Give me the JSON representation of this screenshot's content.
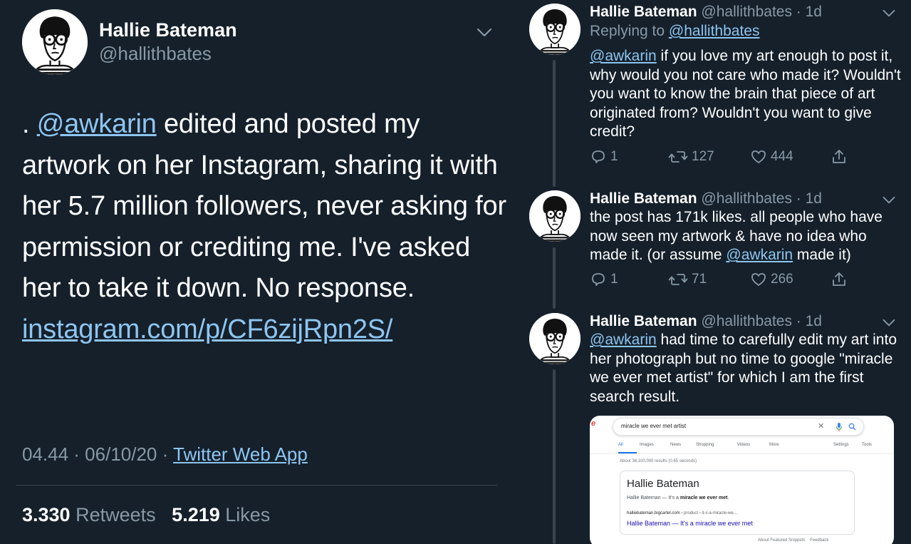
{
  "main_tweet": {
    "author_name": "Hallie Bateman",
    "author_handle": "@hallithbates",
    "text_prefix": ". ",
    "mention": "@awkarin",
    "text_body": " edited and posted my artwork on her Instagram, sharing it with her 5.7 million followers, never asking for permission or crediting me. I've asked her to take it down. No response. ",
    "link_text": "instagram.com/p/​CF6zijRpn2S/",
    "timestamp": "04.44 · 06/10/20 · ",
    "source": "Twitter Web App",
    "retweets_count": "3.330",
    "retweets_label": "Retweets",
    "likes_count": "5.219",
    "likes_label": "Likes"
  },
  "replies": [
    {
      "author_name": "Hallie Bateman",
      "author_handle": "@hallithbates",
      "time": " · 1d",
      "replying_prefix": "Replying to ",
      "replying_handle": "@hallithbates",
      "mention": "@awkarin",
      "text": " if you love my art enough to post it, why would you not care who made it? Wouldn't you want to know the brain that piece of art originated from? Wouldn't you want to give credit?",
      "replies": "1",
      "retweets": "127",
      "likes": "444"
    },
    {
      "author_name": "Hallie Bateman",
      "author_handle": "@hallithbates",
      "time": " · 1d",
      "text_before": "the post has 171k likes. all people who have now seen my artwork & have no idea who made it. (or assume ",
      "mention": "@awkarin",
      "text_after": " made it)",
      "replies": "1",
      "retweets": "71",
      "likes": "266"
    },
    {
      "author_name": "Hallie Bateman",
      "author_handle": "@hallithbates",
      "time": " · 1d",
      "mention": "@awkarin",
      "text": " had time to carefully edit my art into her photograph but no time to google \"miracle we ever met artist\" for which I am the first search result."
    }
  ],
  "search_card": {
    "logo_fragment": "e",
    "query": "miracle we ever met artist",
    "tabs": [
      "All",
      "Images",
      "News",
      "Shopping",
      "Videos",
      "More",
      "Settings",
      "Tools"
    ],
    "result_count": "About 38,100,000 results (0.65 seconds)",
    "result_title": "Hallie Bateman",
    "snippet_prefix": "Hallie Bateman — It's a ",
    "snippet_bold": "miracle we ever met",
    "snippet_suffix": ".",
    "result_url_domain": "halliebateman.bigcartel.com",
    "result_url_path": " › product › it-s-a-miracle-we...",
    "result_link": "Hallie Bateman — It's a miracle we ever met",
    "footer_left": "About Featured Snippets",
    "footer_right": "Feedback"
  },
  "icons": [
    "chevron-down-icon",
    "reply-icon",
    "retweet-icon",
    "like-icon",
    "share-icon",
    "mic-icon",
    "search-icon",
    "close-icon"
  ],
  "colors": {
    "background": "#15202b",
    "link": "#8ec5f0",
    "secondary_text": "#8899a6",
    "divider": "#38444d"
  }
}
